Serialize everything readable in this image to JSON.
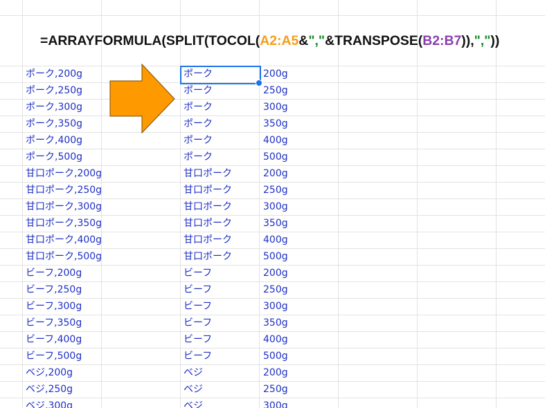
{
  "formula": {
    "parts": [
      {
        "text": "=ARRAYFORMULA(SPLIT(TOCOL(",
        "kind": "fn"
      },
      {
        "text": "A2:A5",
        "kind": "range-a"
      },
      {
        "text": "&",
        "kind": "fn"
      },
      {
        "text": "\",\"",
        "kind": "str"
      },
      {
        "text": "&TRANSPOSE(",
        "kind": "fn"
      },
      {
        "text": "B2:B7",
        "kind": "range-b"
      },
      {
        "text": ")),",
        "kind": "fn"
      },
      {
        "text": "\",\"",
        "kind": "str"
      },
      {
        "text": "))",
        "kind": "fn"
      }
    ],
    "colors": {
      "fn": "#111111",
      "range-a": "#f29e18",
      "range-b": "#8a3db0",
      "str": "#1b8a2c"
    }
  },
  "arrow": {
    "icon": "right-arrow-icon",
    "fill": "#ff9900",
    "stroke": "#7a4a00"
  },
  "selection_color": "#1a73e8",
  "cell_text_color": "#1d2fc4",
  "rows": [
    {
      "combined": "ポーク,200g",
      "name": "ポーク",
      "weight": "200g"
    },
    {
      "combined": "ポーク,250g",
      "name": "ポーク",
      "weight": "250g"
    },
    {
      "combined": "ポーク,300g",
      "name": "ポーク",
      "weight": "300g"
    },
    {
      "combined": "ポーク,350g",
      "name": "ポーク",
      "weight": "350g"
    },
    {
      "combined": "ポーク,400g",
      "name": "ポーク",
      "weight": "400g"
    },
    {
      "combined": "ポーク,500g",
      "name": "ポーク",
      "weight": "500g"
    },
    {
      "combined": "甘口ポーク,200g",
      "name": "甘口ポーク",
      "weight": "200g"
    },
    {
      "combined": "甘口ポーク,250g",
      "name": "甘口ポーク",
      "weight": "250g"
    },
    {
      "combined": "甘口ポーク,300g",
      "name": "甘口ポーク",
      "weight": "300g"
    },
    {
      "combined": "甘口ポーク,350g",
      "name": "甘口ポーク",
      "weight": "350g"
    },
    {
      "combined": "甘口ポーク,400g",
      "name": "甘口ポーク",
      "weight": "400g"
    },
    {
      "combined": "甘口ポーク,500g",
      "name": "甘口ポーク",
      "weight": "500g"
    },
    {
      "combined": "ビーフ,200g",
      "name": "ビーフ",
      "weight": "200g"
    },
    {
      "combined": "ビーフ,250g",
      "name": "ビーフ",
      "weight": "250g"
    },
    {
      "combined": "ビーフ,300g",
      "name": "ビーフ",
      "weight": "300g"
    },
    {
      "combined": "ビーフ,350g",
      "name": "ビーフ",
      "weight": "350g"
    },
    {
      "combined": "ビーフ,400g",
      "name": "ビーフ",
      "weight": "400g"
    },
    {
      "combined": "ビーフ,500g",
      "name": "ビーフ",
      "weight": "500g"
    },
    {
      "combined": "ベジ,200g",
      "name": "ベジ",
      "weight": "200g"
    },
    {
      "combined": "ベジ,250g",
      "name": "ベジ",
      "weight": "250g"
    },
    {
      "combined": "ベジ,300g",
      "name": "ベジ",
      "weight": "300g"
    }
  ]
}
